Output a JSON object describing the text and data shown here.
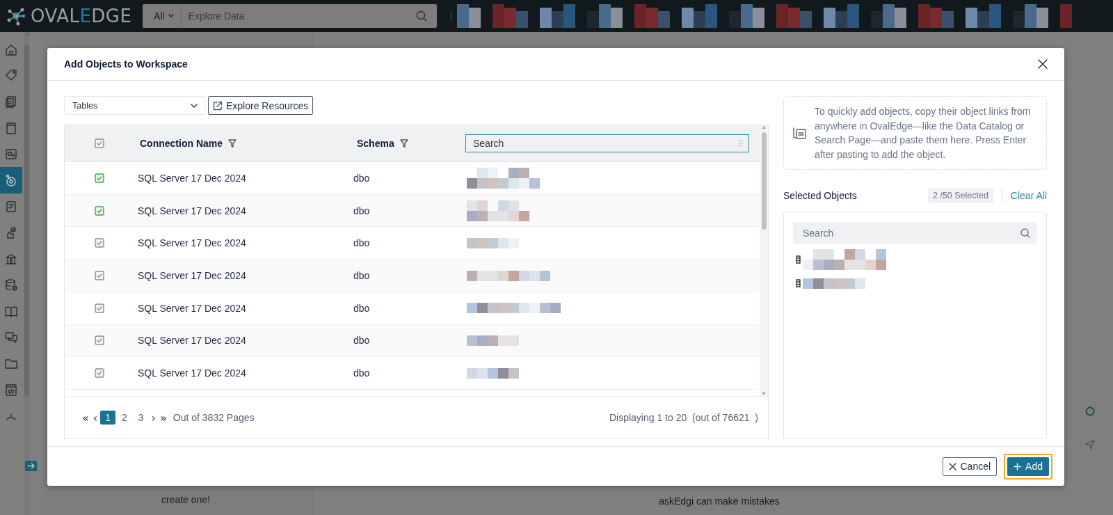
{
  "topbar": {
    "logo": {
      "before": "OVAL",
      "accent": "E",
      "after": "DGE"
    },
    "search": {
      "scope": "All",
      "placeholder": "Explore Data"
    }
  },
  "sidebar": {
    "items": [
      {
        "kind": "home",
        "selected": false
      },
      {
        "kind": "tag",
        "selected": false
      },
      {
        "kind": "documents",
        "selected": false
      },
      {
        "kind": "book",
        "selected": false
      },
      {
        "kind": "report",
        "selected": false
      },
      {
        "kind": "workspace",
        "selected": true
      },
      {
        "kind": "checklist",
        "selected": false
      },
      {
        "kind": "hand",
        "selected": false
      },
      {
        "kind": "bank",
        "selected": false
      },
      {
        "kind": "database",
        "selected": false
      },
      {
        "kind": "openbook",
        "selected": false
      },
      {
        "kind": "chat",
        "selected": false
      },
      {
        "kind": "folder",
        "selected": false
      },
      {
        "kind": "code",
        "selected": false
      }
    ]
  },
  "background": {
    "left_text": "create one!",
    "footer_text": "askEdgi can make mistakes"
  },
  "modal": {
    "title": "Add Objects to Workspace",
    "object_type": "Tables",
    "explore_button": "Explore Resources",
    "table": {
      "header_checked": false,
      "columns": [
        "Connection Name",
        "Schema"
      ],
      "search_placeholder": "Search",
      "rows": [
        {
          "checked": true,
          "connection": "SQL Server 17 Dec 2024",
          "schema": "dbo"
        },
        {
          "checked": true,
          "connection": "SQL Server 17 Dec 2024",
          "schema": "dbo"
        },
        {
          "checked": false,
          "connection": "SQL Server 17 Dec 2024",
          "schema": "dbo"
        },
        {
          "checked": false,
          "connection": "SQL Server 17 Dec 2024",
          "schema": "dbo"
        },
        {
          "checked": false,
          "connection": "SQL Server 17 Dec 2024",
          "schema": "dbo"
        },
        {
          "checked": false,
          "connection": "SQL Server 17 Dec 2024",
          "schema": "dbo"
        },
        {
          "checked": false,
          "connection": "SQL Server 17 Dec 2024",
          "schema": "dbo"
        }
      ]
    },
    "pagination": {
      "first": "«",
      "prev": "‹",
      "pages": [
        {
          "label": "1",
          "selected": true
        },
        {
          "label": "2",
          "selected": false
        },
        {
          "label": "3",
          "selected": false
        }
      ],
      "next": "›",
      "last": "»",
      "total_pages": "Out of 3832 Pages",
      "displaying": "Displaying 1 to 20  (out of 76621  )"
    },
    "hint": "To quickly add objects, copy their object links from anywhere in OvalEdge—like the Data Catalog or Search Page—and paste them here. Press Enter after pasting to add the object.",
    "selected_objects": {
      "title": "Selected Objects",
      "count": "2 /50 Selected",
      "clear": "Clear All",
      "search_placeholder": "Search",
      "items": [
        {
          "kind": "table"
        },
        {
          "kind": "table"
        }
      ]
    },
    "footer": {
      "cancel": "Cancel",
      "add": {
        "label": "Add",
        "focused": true
      }
    }
  }
}
